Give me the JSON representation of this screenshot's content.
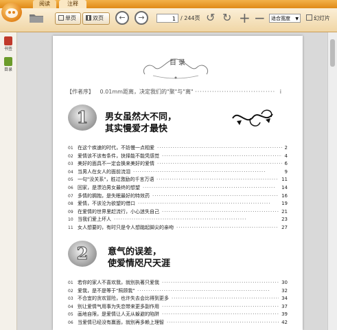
{
  "tabs": [
    "阅读",
    "注释"
  ],
  "toolbar": {
    "single_page": "单页",
    "double_page": "双页",
    "current_page": "1",
    "total_pages": "/ 244页",
    "zoom": "适合宽度",
    "slideshow": "幻灯片"
  },
  "sidebar": {
    "items": [
      {
        "label": "书签",
        "icon": "bookmark-icon",
        "color": "#c0392b"
      },
      {
        "label": "目录",
        "icon": "toc-icon",
        "color": "#6b9b2a"
      }
    ]
  },
  "doc": {
    "heading": "目录",
    "preface_label": "【作者序】",
    "preface_text": "0.01mm距离，决定我们的\"聚\"与\"离\"",
    "preface_page": "i",
    "sections": [
      {
        "number": "1",
        "title_line1": "男女虽然大不同，",
        "title_line2": "其实慢爱才最快",
        "entries": [
          {
            "no": "01",
            "text": "在这个疾速的时代，不妨慢一点相爱",
            "page": "2"
          },
          {
            "no": "02",
            "text": "爱情该不该有条件，抉择能不能凭感觉",
            "page": "4"
          },
          {
            "no": "03",
            "text": "美好的面具不一定会换来美好的爱情",
            "page": "6"
          },
          {
            "no": "04",
            "text": "当男人在女人的面前流泪",
            "page": "9"
          },
          {
            "no": "05",
            "text": "一句\"没关系\"，胜过激励的千言万语",
            "page": "11"
          },
          {
            "no": "06",
            "text": "回家，是漂泊男女最终的想望",
            "page": "14"
          },
          {
            "no": "07",
            "text": "多情的拥抱，是失眠最好的特效药",
            "page": "16"
          },
          {
            "no": "08",
            "text": "爱情，不该沦为欲望的借口",
            "page": "19"
          },
          {
            "no": "09",
            "text": "在爱情的世界里赶流行，小心迷失自己",
            "page": "21"
          },
          {
            "no": "10",
            "text": "当我们爱上坏人",
            "page": "23"
          },
          {
            "no": "11",
            "text": "女人想要的，有时只是令人想踮起脚尖的亲吻",
            "page": "27"
          }
        ]
      },
      {
        "number": "2",
        "title_line1": "意气的误差，",
        "title_line2": "使爱情咫尺天涯",
        "entries": [
          {
            "no": "01",
            "text": "若你的家人不喜欢我，就别执著只爱我",
            "page": "30"
          },
          {
            "no": "02",
            "text": "爱我，是不是等于\"照顾我\"",
            "page": "32"
          },
          {
            "no": "03",
            "text": "不合宜的贪欢冒险，也许失去会比得到更多",
            "page": "34"
          },
          {
            "no": "04",
            "text": "别让爱情气用事为失恋带来更多副作用",
            "page": "37"
          },
          {
            "no": "05",
            "text": "画地自限，是爱情让人无从躲避的陷阱",
            "page": "39"
          },
          {
            "no": "06",
            "text": "当爱情已经没有赢面，就别再多赖上理智",
            "page": "42"
          }
        ]
      }
    ]
  }
}
